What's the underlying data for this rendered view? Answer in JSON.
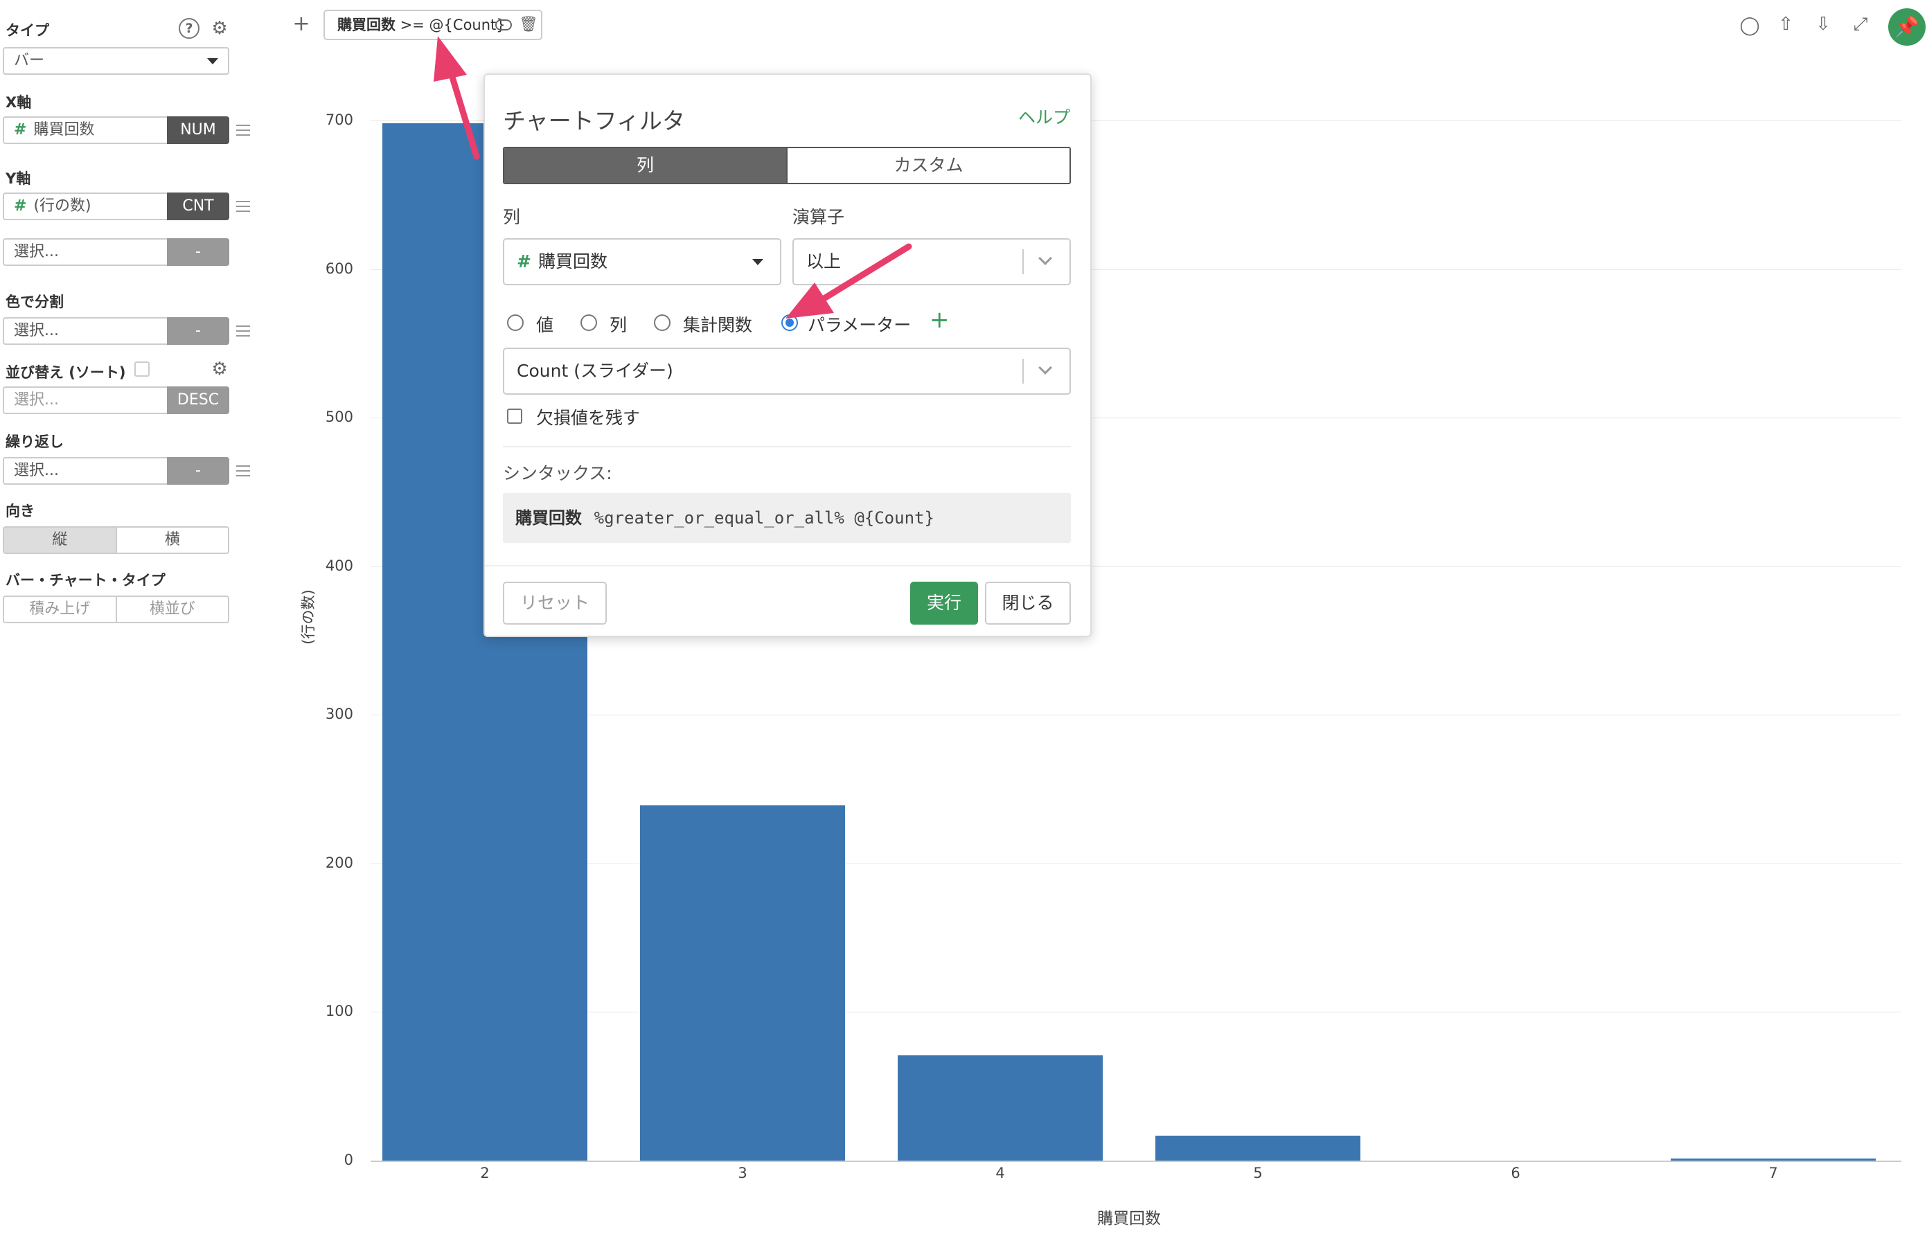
{
  "sidebar": {
    "type_label": "タイプ",
    "type_value": "バー",
    "x_axis_label": "X軸",
    "x_axis_value": "購買回数",
    "x_axis_tag": "NUM",
    "y_axis_label": "Y軸",
    "y_axis_value": "(行の数)",
    "y_axis_tag": "CNT",
    "y_axis2_value": "選択...",
    "y_axis2_tag": "-",
    "color_label": "色で分割",
    "color_value": "選択...",
    "color_tag": "-",
    "sort_label": "並び替え (ソート)",
    "sort_value": "選択...",
    "sort_tag": "DESC",
    "repeat_label": "繰り返し",
    "repeat_value": "選択...",
    "repeat_tag": "-",
    "orientation_label": "向き",
    "orientation_options": [
      "縦",
      "横"
    ],
    "bar_type_label": "バー・チャート・タイプ",
    "bar_type_options": [
      "積み上げ",
      "横並び"
    ]
  },
  "filter_chip": {
    "column": "購買回数",
    "expression": " >= @{Count}"
  },
  "toolbar_icons": [
    "comment-icon",
    "upload-icon",
    "download-icon",
    "expand-icon",
    "pin-icon"
  ],
  "modal": {
    "title": "チャートフィルタ",
    "help": "ヘルプ",
    "tabs": [
      "列",
      "カスタム"
    ],
    "column_label": "列",
    "column_value": "購買回数",
    "operator_label": "演算子",
    "operator_value": "以上",
    "radio_options": [
      "値",
      "列",
      "集計関数",
      "パラメーター"
    ],
    "selected_radio": "パラメーター",
    "parameter_value": "Count (スライダー)",
    "keep_na_label": "欠損値を残す",
    "syntax_label": "シンタックス:",
    "syntax_column": "購買回数",
    "syntax_expression": "%greater_or_equal_or_all% @{Count}",
    "reset_button": "リセット",
    "run_button": "実行",
    "close_button": "閉じる"
  },
  "colors": {
    "bar": "#3b76b0",
    "accent_green": "#3a9a5b",
    "annotation_arrow": "#e83e6c",
    "radio_blue": "#2f7de1"
  },
  "chart_data": {
    "type": "bar",
    "categories": [
      "2",
      "3",
      "4",
      "5",
      "6",
      "7"
    ],
    "values": [
      698,
      239,
      71,
      17,
      0,
      1
    ],
    "xlabel": "購買回数",
    "ylabel": "(行の数)",
    "ylim": [
      0,
      700
    ],
    "yticks": [
      0,
      100,
      200,
      300,
      400,
      500,
      600,
      700
    ],
    "grid": true
  }
}
